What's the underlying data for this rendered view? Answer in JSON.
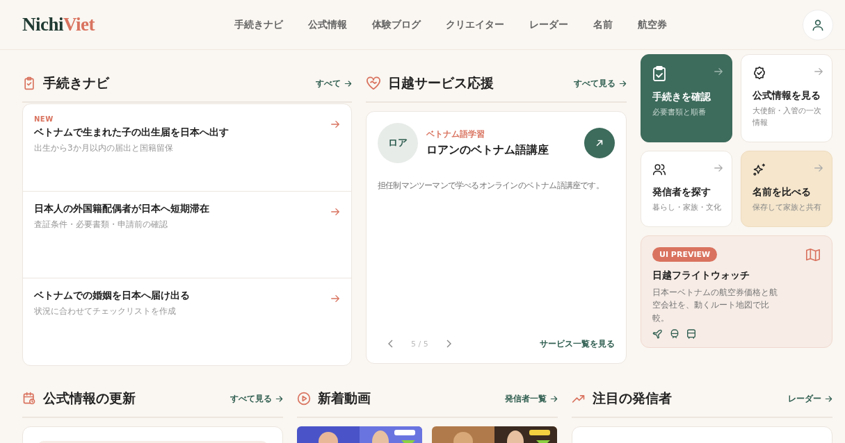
{
  "header": {
    "logo_dark": "Nichi",
    "logo_accent": "Viet",
    "nav": [
      {
        "label": "手続きナビ"
      },
      {
        "label": "公式情報"
      },
      {
        "label": "体験ブログ"
      },
      {
        "label": "クリエイター"
      },
      {
        "label": "レーダー"
      },
      {
        "label": "名前"
      },
      {
        "label": "航空券"
      }
    ]
  },
  "procedures": {
    "title": "手続きナビ",
    "link": "すべて",
    "items": [
      {
        "badge": "NEW",
        "title": "ベトナムで生まれた子の出生届を日本へ出す",
        "subtitle": "出生から3か月以内の届出と国籍留保"
      },
      {
        "title": "日本人の外国籍配偶者が日本へ短期滞在",
        "subtitle": "査証条件・必要書類・申請前の確認"
      },
      {
        "title": "ベトナムでの婚姻を日本へ届け出る",
        "subtitle": "状況に合わせてチェックリストを作成"
      }
    ]
  },
  "services": {
    "title": "日越サービス応援",
    "link": "すべて見る",
    "card": {
      "avatar": "ロア",
      "category": "ベトナム語学習",
      "name": "ロアンのベトナム語講座",
      "description": "担任制マンツーマンで学べるオンラインのベトナム語講座です。",
      "pager": "5 / 5",
      "list_link": "サービス一覧を見る"
    }
  },
  "quick_links": [
    {
      "title": "手続きを確認",
      "subtitle": "必要書類と順番"
    },
    {
      "title": "公式情報を見る",
      "subtitle": "大使館・入管の一次情報"
    },
    {
      "title": "発信者を探す",
      "subtitle": "暮らし・家族・文化"
    },
    {
      "title": "名前を比べる",
      "subtitle": "保存して家族と共有"
    }
  ],
  "flight": {
    "badge": "UI PREVIEW",
    "title": "日越フライトウォッチ",
    "description": "日本ーベトナムの航空券価格と航空会社を、動くルート地図で比較。"
  },
  "bottom": [
    {
      "title": "公式情報の更新",
      "link": "すべて見る"
    },
    {
      "title": "新着動画",
      "link": "発信者一覧"
    },
    {
      "title": "注目の発信者",
      "link": "レーダー"
    }
  ]
}
